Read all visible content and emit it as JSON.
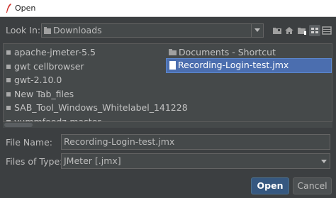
{
  "window": {
    "title": "Open"
  },
  "look_in": {
    "label": "Look In:",
    "value": "Downloads"
  },
  "toolbar": {
    "icons": [
      "up-folder-icon",
      "home-icon",
      "new-folder-icon",
      "list-view-icon",
      "details-view-icon"
    ]
  },
  "files": {
    "column1": [
      {
        "name": "apache-jmeter-5.5",
        "type": "folder"
      },
      {
        "name": "gwt cellbrowser",
        "type": "folder"
      },
      {
        "name": "gwt-2.10.0",
        "type": "folder"
      },
      {
        "name": "New Tab_files",
        "type": "folder"
      },
      {
        "name": "SAB_Tool_Windows_Whitelabel_141228",
        "type": "folder"
      },
      {
        "name": "yummfoodz-master",
        "type": "folder"
      }
    ],
    "column2": [
      {
        "name": "Documents - Shortcut",
        "type": "folder"
      },
      {
        "name": "Recording-Login-test.jmx",
        "type": "file",
        "selected": true
      }
    ]
  },
  "file_name": {
    "label": "File Name:",
    "value": "Recording-Login-test.jmx"
  },
  "file_type": {
    "label": "Files of Type:",
    "value": "JMeter [.jmx]"
  },
  "buttons": {
    "open": "Open",
    "cancel": "Cancel"
  },
  "colors": {
    "background": "#3c3f41",
    "selection": "#4b6eaf",
    "primary_button": "#365880"
  }
}
